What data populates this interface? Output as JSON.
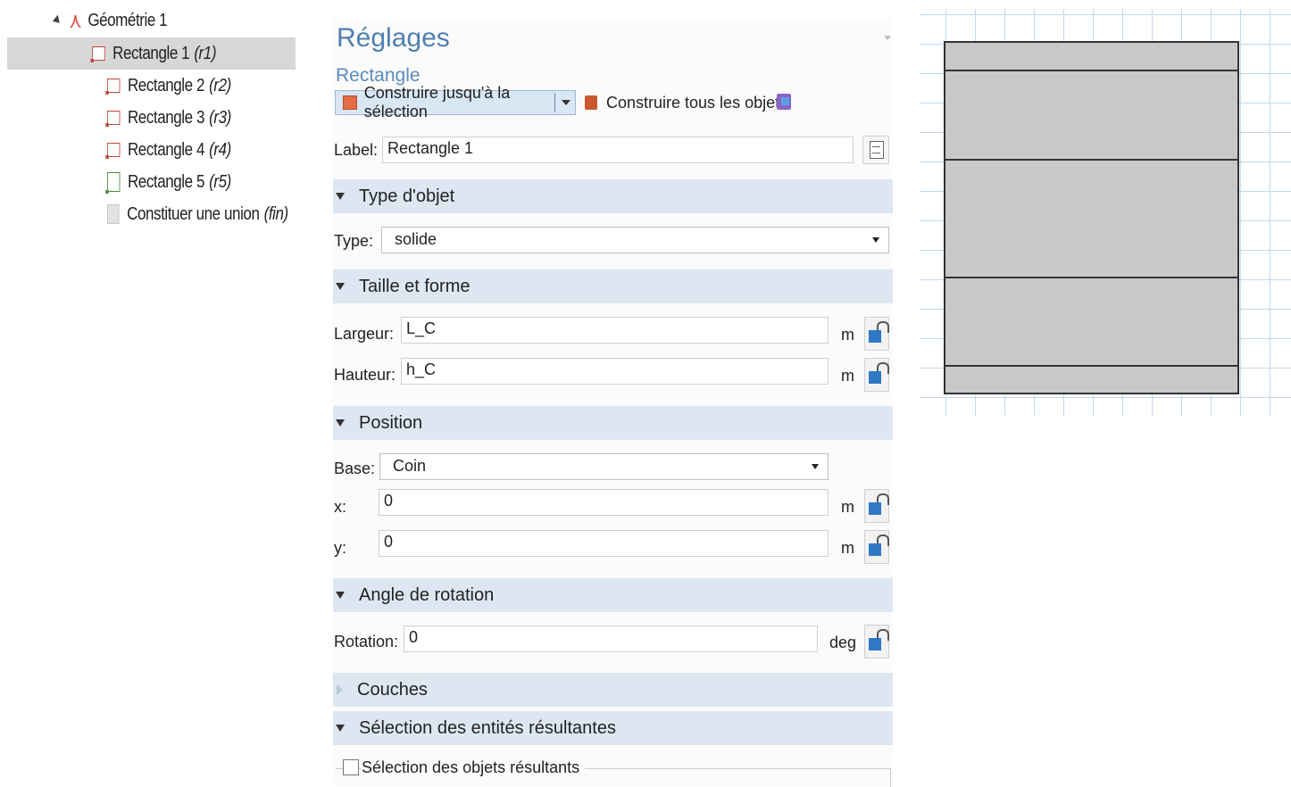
{
  "tree": {
    "root": "Géométrie 1",
    "items": [
      {
        "label": "Rectangle 1",
        "tag": "(r1)"
      },
      {
        "label": "Rectangle 2",
        "tag": "(r2)"
      },
      {
        "label": "Rectangle 3",
        "tag": "(r3)"
      },
      {
        "label": "Rectangle 4",
        "tag": "(r4)"
      },
      {
        "label": "Rectangle 5",
        "tag": "(r5)"
      },
      {
        "label": "Constituer une union",
        "tag": "(fin)"
      }
    ],
    "selected_index": 0
  },
  "settings": {
    "title": "Réglages",
    "subtitle": "Rectangle",
    "build_selected": "Construire jusqu'à la sélection",
    "build_all": "Construire tous les objets",
    "label_caption": "Label:",
    "label_value": "Rectangle 1",
    "sections": {
      "object_type": "Type d'objet",
      "size_shape": "Taille et forme",
      "position": "Position",
      "rotation": "Angle de rotation",
      "layers": "Couches",
      "selections": "Sélection des entités résultantes"
    },
    "type_caption": "Type:",
    "type_value": "solide",
    "width_caption": "Largeur:",
    "width_value": "L_C",
    "height_caption": "Hauteur:",
    "height_value": "h_C",
    "base_caption": "Base:",
    "base_value": "Coin",
    "x_caption": "x:",
    "x_value": "0",
    "y_caption": "y:",
    "y_value": "0",
    "rotation_caption": "Rotation:",
    "rotation_value": "0",
    "unit_m": "m",
    "unit_deg": "deg",
    "result_objects": "Sélection des objets résultants"
  },
  "colors": {
    "title": "#4f7fb0",
    "section_bg": "#dde7f2",
    "grid": "#c3d7ea",
    "geometry_fill": "#c8c8c8"
  }
}
